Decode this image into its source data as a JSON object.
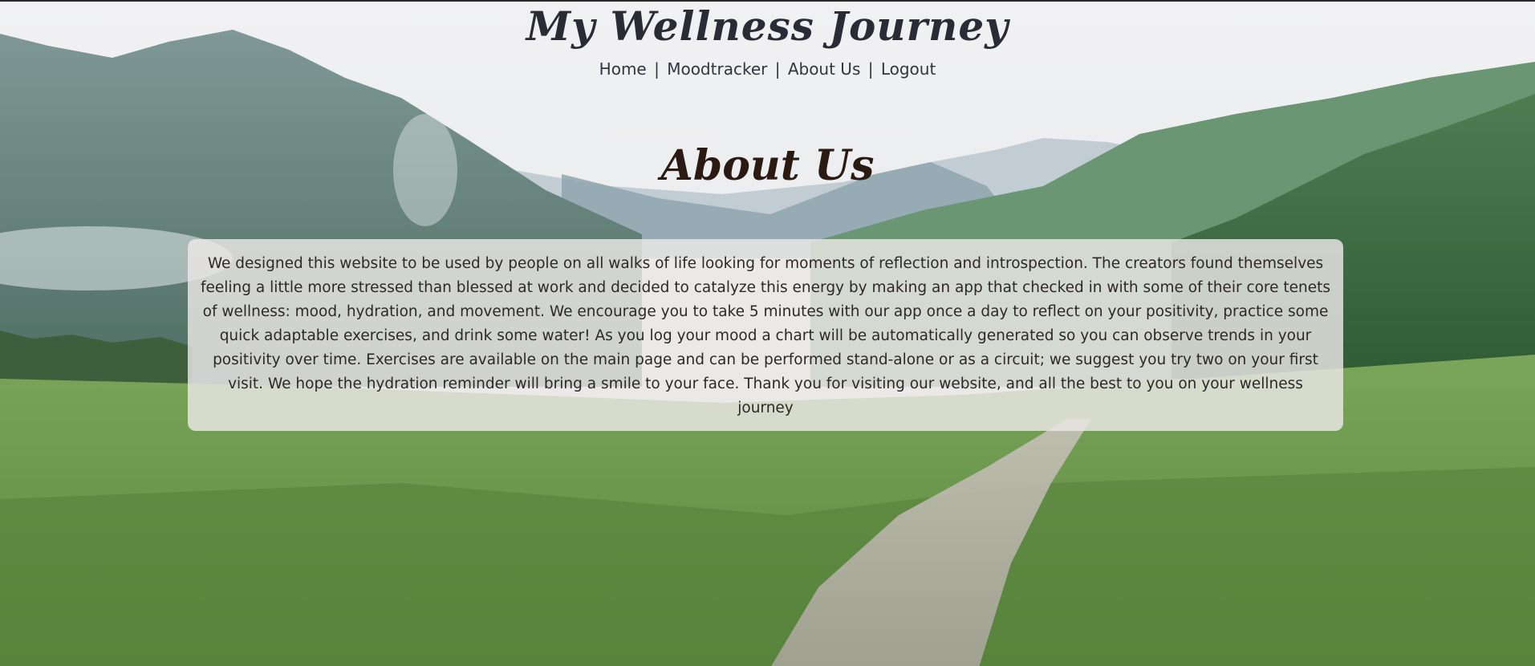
{
  "header": {
    "site_title": "My Wellness Journey",
    "nav": {
      "home": "Home",
      "moodtracker": "Moodtracker",
      "about": "About Us",
      "logout": "Logout",
      "separator": "|"
    }
  },
  "main": {
    "heading": "About Us",
    "body": "We designed this website to be used by people on all walks of life looking for moments of reflection and introspection. The creators found themselves feeling a little more stressed than blessed at work and decided to catalyze this energy by making an app that checked in with some of their core tenets of wellness: mood, hydration, and movement. We encourage you to take 5 minutes with our app once a day to reflect on your positivity, practice some quick adaptable exercises, and drink some water! As you log your mood a chart will be automatically generated so you can observe trends in your positivity over time. Exercises are available on the main page and can be performed stand-alone or as a circuit; we suggest you try two on your first visit. We hope the hydration reminder will bring a smile to your face. Thank you for visiting our website, and all the best to you on your wellness journey"
  },
  "background": {
    "sky": "#eef0f3",
    "mountain_far": "#a7b6c0",
    "mountain_mid": "#7f97a0",
    "mountain_left": "#6b8783",
    "forest_right": "#3f6b45",
    "grass": "#6d9a4e",
    "path": "#b9b4a8"
  }
}
